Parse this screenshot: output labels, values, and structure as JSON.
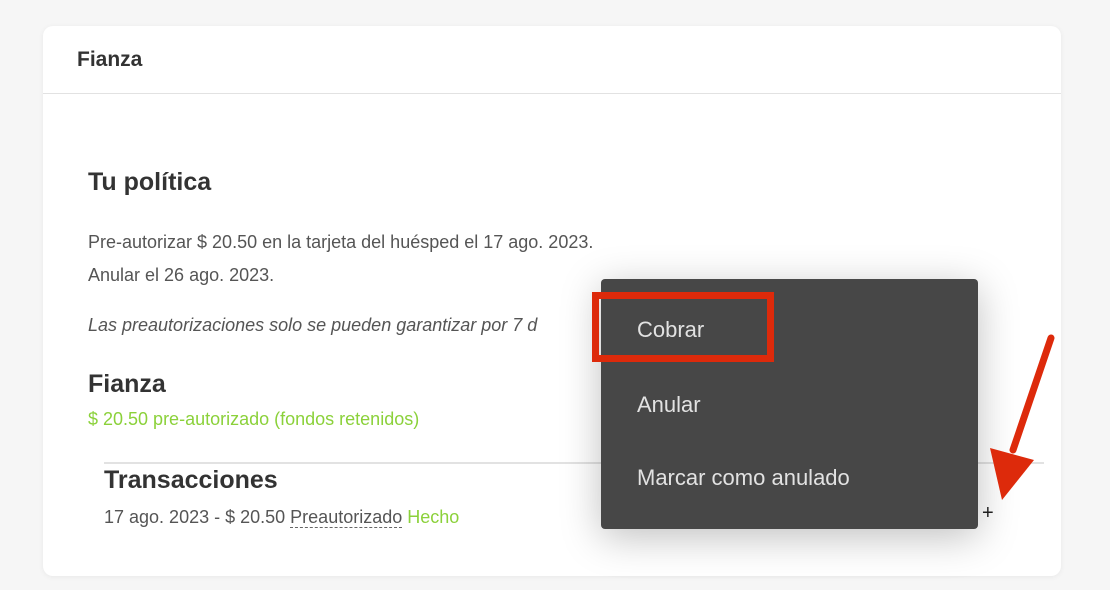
{
  "card": {
    "header_title": "Fianza"
  },
  "policy": {
    "title": "Tu política",
    "line1": "Pre-autorizar $ 20.50 en la tarjeta del huésped el 17 ago. 2023.",
    "line2": "Anular el 26 ago. 2023.",
    "note": "Las preautorizaciones solo se pueden garantizar por 7 d"
  },
  "deposit": {
    "title": "Fianza",
    "status": "$ 20.50 pre-autorizado (fondos retenidos)"
  },
  "transactions": {
    "title": "Transacciones",
    "row": {
      "date_amount": "17 ago. 2023 - $ 20.50",
      "status": "Preautorizado",
      "result": "Hecho"
    },
    "add_symbol": "+"
  },
  "menu": {
    "items": [
      {
        "label": "Cobrar"
      },
      {
        "label": "Anular"
      },
      {
        "label": "Marcar como anulado"
      }
    ]
  },
  "colors": {
    "accent_green": "#8bd13a",
    "menu_bg": "#474747",
    "annotation_red": "#dd2a0b"
  }
}
